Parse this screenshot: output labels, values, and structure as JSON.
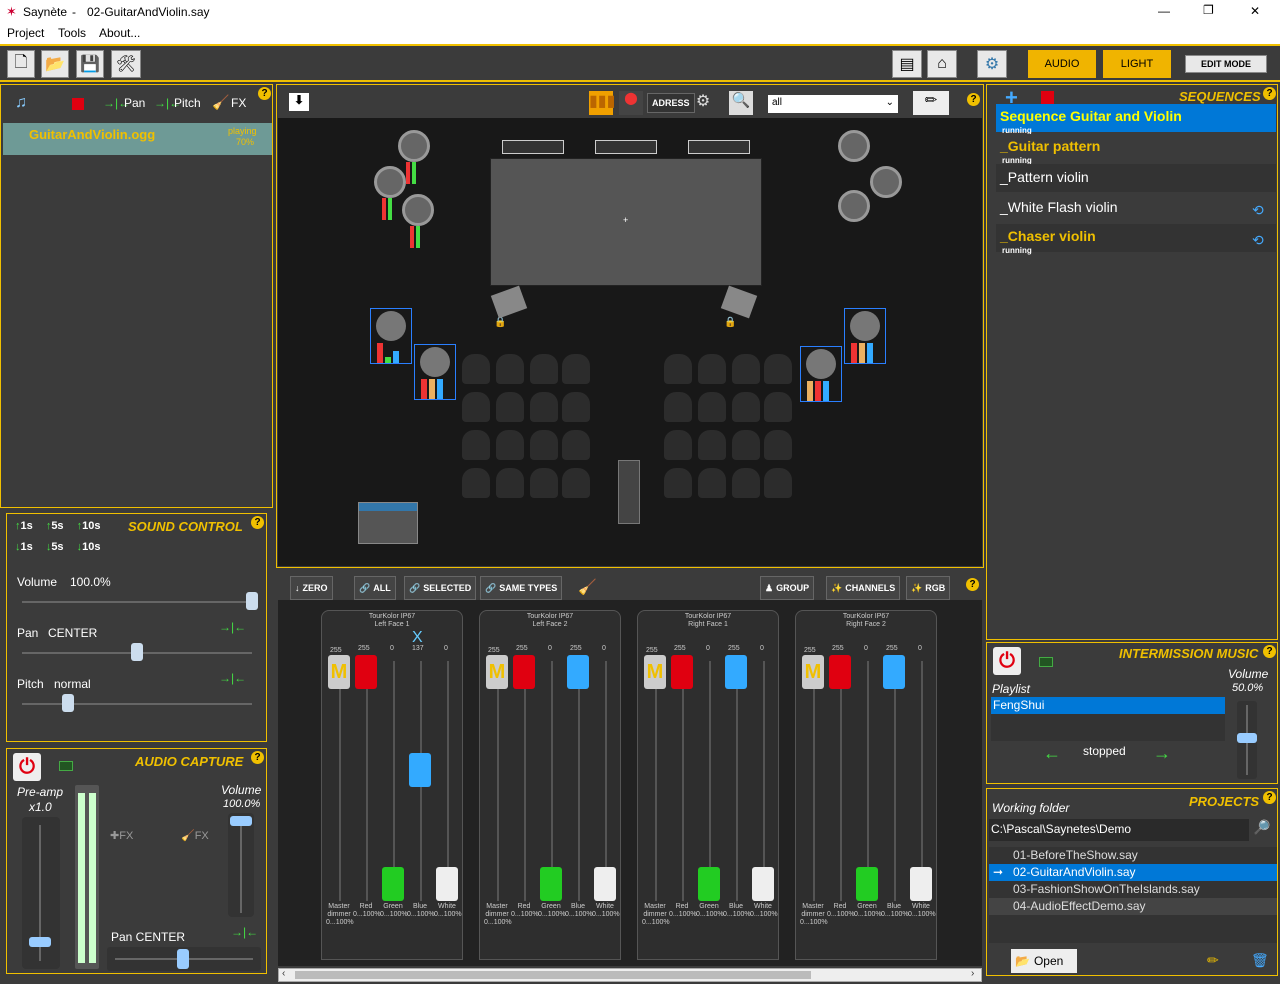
{
  "app": {
    "name": "Saynète",
    "separator": "-",
    "file": "02-GuitarAndViolin.say"
  },
  "window_controls": {
    "minimize": "—",
    "restore": "❐",
    "close": "✕"
  },
  "menu": [
    "Project",
    "Tools",
    "About..."
  ],
  "toolbar": {
    "audio_label": "AUDIO",
    "light_label": "LIGHT",
    "edit_mode_label": "EDIT MODE"
  },
  "audio_player": {
    "pan_label": "Pan",
    "pitch_label": "Pitch",
    "fx_label": "FX",
    "track_name": "GuitarAndViolin.ogg",
    "track_status": "playing",
    "track_progress": "70%"
  },
  "sound_control": {
    "title": "SOUND CONTROL",
    "fade_up": [
      "1s",
      "5s",
      "10s"
    ],
    "fade_down": [
      "1s",
      "5s",
      "10s"
    ],
    "volume_label": "Volume",
    "volume_value": "100.0%",
    "volume_level": 1.0,
    "pan_label": "Pan",
    "pan_value": "CENTER",
    "pan_level": 0.5,
    "pitch_label": "Pitch",
    "pitch_value": "normal",
    "pitch_level": 0.2
  },
  "audio_capture": {
    "title": "AUDIO CAPTURE",
    "preamp_label": "Pre-amp",
    "preamp_value": "x1.0",
    "volume_label": "Volume",
    "volume_value": "100.0%",
    "fx1_label": "FX",
    "fx2_label": "FX",
    "pan_label": "Pan CENTER"
  },
  "stage": {
    "filter_value": "all",
    "adress_label": "ADRESS"
  },
  "mixer": {
    "buttons": {
      "zero": "ZERO",
      "all": "ALL",
      "selected": "SELECTED",
      "same_types": "SAME TYPES",
      "group": "GROUP",
      "channels": "CHANNELS",
      "rgb": "RGB"
    },
    "strips": [
      {
        "model": "TourKolor IP67",
        "name": "Left Face 1",
        "values": [
          "255",
          "255",
          "0",
          "137",
          "0"
        ]
      },
      {
        "model": "TourKolor IP67",
        "name": "Left Face 2",
        "values": [
          "255",
          "255",
          "0",
          "255",
          "0"
        ]
      },
      {
        "model": "TourKolor IP67",
        "name": "Right Face 1",
        "values": [
          "255",
          "255",
          "0",
          "255",
          "0"
        ]
      },
      {
        "model": "TourKolor IP67",
        "name": "Right Face 2",
        "values": [
          "255",
          "255",
          "0",
          "255",
          "0"
        ]
      }
    ],
    "channel_labels": [
      {
        "name": "Master dimmer",
        "range": "0...100%"
      },
      {
        "name": "Red",
        "range": "0...100%"
      },
      {
        "name": "Green",
        "range": "0...100%"
      },
      {
        "name": "Blue",
        "range": "0...100%"
      },
      {
        "name": "White",
        "range": "0...100%"
      }
    ],
    "master_glyph": "M",
    "selection_mark": "X"
  },
  "sequences": {
    "title": "SEQUENCES",
    "items": [
      {
        "name": "Sequence Guitar and Violin",
        "status": "running",
        "selected": true,
        "loop": false
      },
      {
        "name": "_Guitar pattern",
        "status": "running",
        "selected": false,
        "loop": false
      },
      {
        "name": "_Pattern violin",
        "status": "",
        "selected": false,
        "loop": false
      },
      {
        "name": "_White Flash violin",
        "status": "",
        "selected": false,
        "loop": true
      },
      {
        "name": "_Chaser violin",
        "status": "running",
        "selected": false,
        "loop": true
      }
    ]
  },
  "intermission": {
    "title": "INTERMISSION MUSIC",
    "playlist_label": "Playlist",
    "playlist": [
      "FengShui"
    ],
    "volume_label": "Volume",
    "volume_value": "50.0%",
    "state": "stopped"
  },
  "projects": {
    "title": "PROJECTS",
    "folder_label": "Working folder",
    "folder_value": "C:\\Pascal\\Saynetes\\Demo",
    "files": [
      "01-BeforeTheShow.say",
      "02-GuitarAndViolin.say",
      "03-FashionShowOnTheIslands.say",
      "04-AudioEffectDemo.say"
    ],
    "open_label": "Open"
  },
  "colors": {
    "accent": "#f0c000",
    "selected": "#0078d7",
    "bg": "#3b3b3b"
  }
}
